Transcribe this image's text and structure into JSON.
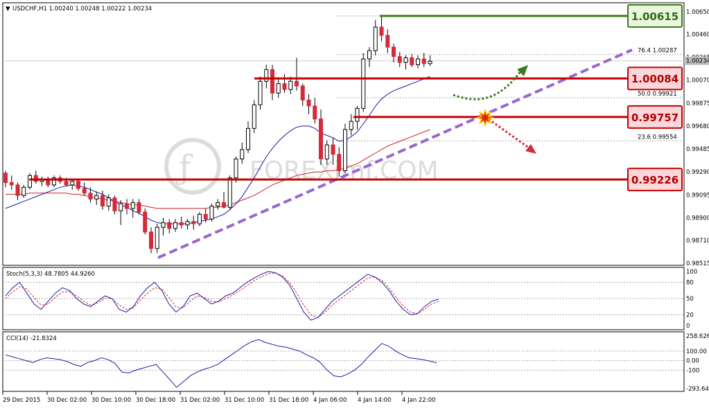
{
  "header": {
    "symbol_line": "USDCHF,H1  1.00240 1.00248 1.00222 1.00234"
  },
  "colors": {
    "bull": "#000000",
    "bear": "#d42a3b",
    "ma_fast": "#1a1aa6",
    "ma_slow": "#cc2222",
    "trendline": "#9966cc",
    "level_line": "#c40000",
    "top_level_line": "#3c7a1e",
    "stoch_main": "#1a1aa6",
    "stoch_signal": "#dd2222",
    "cci": "#1a1aa6"
  },
  "chart_data": [
    {
      "type": "candlestick",
      "symbol": "USDCHF",
      "timeframe": "H1",
      "ylim": [
        0.98515,
        1.0065
      ],
      "y_ticks": [
        "1.00650",
        "1.00460",
        "1.00265",
        "1.00070",
        "0.99875",
        "0.99680",
        "0.99485",
        "0.99290",
        "0.99095",
        "0.98900",
        "0.98710",
        "0.98515"
      ],
      "current_price": "1.00234",
      "x_tick_labels": [
        "29 Dec 2015",
        "30 Dec 02:00",
        "30 Dec 10:00",
        "30 Dec 18:00",
        "31 Dec 02:00",
        "31 Dec 10:00",
        "31 Dec 18:00",
        "4 Jan 06:00",
        "4 Jan 14:00",
        "4 Jan 22:00"
      ],
      "candles": [
        [
          0.9928,
          0.993,
          0.9916,
          0.992
        ],
        [
          0.992,
          0.9926,
          0.9914,
          0.9918
        ],
        [
          0.9918,
          0.992,
          0.9905,
          0.9909
        ],
        [
          0.9909,
          0.9918,
          0.9907,
          0.9916
        ],
        [
          0.9916,
          0.9928,
          0.9914,
          0.9926
        ],
        [
          0.9926,
          0.993,
          0.9919,
          0.9921
        ],
        [
          0.9921,
          0.9925,
          0.9917,
          0.9923
        ],
        [
          0.9923,
          0.9925,
          0.9916,
          0.9918
        ],
        [
          0.9918,
          0.9926,
          0.9916,
          0.9924
        ],
        [
          0.9924,
          0.9926,
          0.9919,
          0.9921
        ],
        [
          0.9921,
          0.9924,
          0.9917,
          0.9918
        ],
        [
          0.9918,
          0.9922,
          0.9914,
          0.9921
        ],
        [
          0.9921,
          0.9922,
          0.9913,
          0.9915
        ],
        [
          0.9915,
          0.992,
          0.9909,
          0.9911
        ],
        [
          0.9911,
          0.9916,
          0.9903,
          0.9906
        ],
        [
          0.9906,
          0.9912,
          0.9901,
          0.9909
        ],
        [
          0.9909,
          0.9913,
          0.9897,
          0.99
        ],
        [
          0.99,
          0.991,
          0.9896,
          0.9907
        ],
        [
          0.9907,
          0.9909,
          0.9893,
          0.9896
        ],
        [
          0.9896,
          0.9905,
          0.9884,
          0.9902
        ],
        [
          0.9902,
          0.9906,
          0.9893,
          0.9898
        ],
        [
          0.9898,
          0.9906,
          0.989,
          0.9903
        ],
        [
          0.9903,
          0.9906,
          0.9893,
          0.9895
        ],
        [
          0.9895,
          0.9898,
          0.9876,
          0.9878
        ],
        [
          0.9878,
          0.9882,
          0.986,
          0.9864
        ],
        [
          0.9864,
          0.9885,
          0.986,
          0.9882
        ],
        [
          0.9882,
          0.989,
          0.9875,
          0.9886
        ],
        [
          0.9886,
          0.9889,
          0.9877,
          0.9881
        ],
        [
          0.9881,
          0.9889,
          0.9878,
          0.9886
        ],
        [
          0.9886,
          0.9891,
          0.9881,
          0.9884
        ],
        [
          0.9884,
          0.9889,
          0.988,
          0.9887
        ],
        [
          0.9887,
          0.9892,
          0.988,
          0.9885
        ],
        [
          0.9885,
          0.9895,
          0.9883,
          0.9893
        ],
        [
          0.9893,
          0.9898,
          0.9886,
          0.9889
        ],
        [
          0.9889,
          0.9902,
          0.9887,
          0.99
        ],
        [
          0.99,
          0.9906,
          0.9897,
          0.9903
        ],
        [
          0.9903,
          0.9912,
          0.9898,
          0.9899
        ],
        [
          0.9899,
          0.9926,
          0.9897,
          0.9924
        ],
        [
          0.9924,
          0.9942,
          0.992,
          0.994
        ],
        [
          0.994,
          0.9954,
          0.9936,
          0.9948
        ],
        [
          0.9948,
          0.9972,
          0.9945,
          0.9966
        ],
        [
          0.9966,
          0.999,
          0.9962,
          0.9986
        ],
        [
          0.9986,
          1.001,
          0.9982,
          1.0006
        ],
        [
          1.0006,
          1.002,
          1.0,
          1.0016
        ],
        [
          1.0016,
          1.002,
          0.999,
          0.9996
        ],
        [
          0.9996,
          1.0008,
          0.9992,
          1.0004
        ],
        [
          1.0004,
          1.0012,
          0.9996,
          0.9999
        ],
        [
          0.9999,
          1.001,
          0.9995,
          1.0006
        ],
        [
          1.0006,
          1.0026,
          0.9998,
          1.0002
        ],
        [
          1.0002,
          1.0004,
          0.9985,
          0.999
        ],
        [
          0.999,
          0.9995,
          0.9978,
          0.9985
        ],
        [
          0.9985,
          0.9992,
          0.997,
          0.9974
        ],
        [
          0.9974,
          0.9982,
          0.9935,
          0.994
        ],
        [
          0.994,
          0.9956,
          0.9935,
          0.9952
        ],
        [
          0.9952,
          0.9958,
          0.9935,
          0.9944
        ],
        [
          0.9944,
          0.995,
          0.9925,
          0.993
        ],
        [
          0.993,
          0.997,
          0.9928,
          0.9965
        ],
        [
          0.9965,
          0.9978,
          0.996,
          0.9972
        ],
        [
          0.9972,
          0.9985,
          0.9965,
          0.9983
        ],
        [
          0.9983,
          1.003,
          0.998,
          1.0025
        ],
        [
          1.0025,
          1.0035,
          1.0018,
          1.0032
        ],
        [
          1.0032,
          1.0058,
          1.0028,
          1.0052
        ],
        [
          1.0052,
          1.0061,
          1.004,
          1.0045
        ],
        [
          1.0045,
          1.005,
          1.003,
          1.0035
        ],
        [
          1.0035,
          1.0038,
          1.0022,
          1.0027
        ],
        [
          1.0027,
          1.0031,
          1.0018,
          1.0022
        ],
        [
          1.0022,
          1.0028,
          1.0016,
          1.0026
        ],
        [
          1.0026,
          1.0029,
          1.0018,
          1.002
        ],
        [
          1.002,
          1.0028,
          1.0017,
          1.0025
        ],
        [
          1.0025,
          1.003,
          1.0018,
          1.0021
        ],
        [
          1.0021,
          1.0028,
          1.0019,
          1.0023
        ]
      ],
      "ma_fast": [
        0.9898,
        0.99,
        0.9902,
        0.9904,
        0.9906,
        0.9908,
        0.991,
        0.9912,
        0.9914,
        0.9916,
        0.9917,
        0.9918,
        0.9917,
        0.9916,
        0.9914,
        0.9912,
        0.991,
        0.9907,
        0.9904,
        0.9901,
        0.9899,
        0.9896,
        0.9894,
        0.9891,
        0.9888,
        0.9886,
        0.9885,
        0.9885,
        0.9885,
        0.9885,
        0.9885,
        0.9886,
        0.9887,
        0.9888,
        0.9889,
        0.9891,
        0.9893,
        0.9897,
        0.9902,
        0.9908,
        0.9916,
        0.9924,
        0.9933,
        0.9942,
        0.9949,
        0.9955,
        0.996,
        0.9964,
        0.9967,
        0.9968,
        0.9968,
        0.9966,
        0.9962,
        0.996,
        0.9958,
        0.9955,
        0.9956,
        0.9959,
        0.9963,
        0.997,
        0.9977,
        0.9985,
        0.9991,
        0.9995,
        0.9998,
        1.0,
        1.0002,
        1.0004,
        1.0006,
        1.0008,
        1.001
      ],
      "ma_slow": [
        0.991,
        0.991,
        0.991,
        0.991,
        0.9911,
        0.9911,
        0.9911,
        0.9911,
        0.9911,
        0.9911,
        0.9911,
        0.991,
        0.991,
        0.9909,
        0.9908,
        0.9907,
        0.9906,
        0.9905,
        0.9904,
        0.9903,
        0.9902,
        0.9901,
        0.9901,
        0.99,
        0.9899,
        0.9898,
        0.9898,
        0.9898,
        0.9898,
        0.9898,
        0.9898,
        0.9898,
        0.9898,
        0.9898,
        0.9899,
        0.9899,
        0.99,
        0.9901,
        0.9903,
        0.9905,
        0.9907,
        0.9909,
        0.9912,
        0.9915,
        0.9918,
        0.992,
        0.9922,
        0.9924,
        0.9926,
        0.9927,
        0.9928,
        0.9929,
        0.9929,
        0.993,
        0.993,
        0.9931,
        0.9932,
        0.9934,
        0.9936,
        0.9939,
        0.9942,
        0.9945,
        0.9948,
        0.9951,
        0.9953,
        0.9955,
        0.9957,
        0.9959,
        0.9961,
        0.9963,
        0.9965
      ]
    },
    {
      "type": "line",
      "name": "Stoch(5,3,3)",
      "label": "Stoch(5,3,3) 48.7805 44.9260",
      "ylim": [
        0,
        100
      ],
      "y_ticks": [
        "100",
        "80",
        "50",
        "20",
        "0"
      ],
      "main": [
        55,
        70,
        80,
        60,
        40,
        30,
        45,
        60,
        70,
        65,
        50,
        40,
        35,
        45,
        55,
        50,
        30,
        25,
        35,
        55,
        70,
        80,
        65,
        40,
        25,
        35,
        55,
        60,
        50,
        40,
        45,
        55,
        60,
        70,
        80,
        88,
        95,
        100,
        98,
        90,
        75,
        50,
        25,
        10,
        15,
        30,
        45,
        55,
        65,
        75,
        85,
        95,
        90,
        80,
        65,
        45,
        30,
        20,
        22,
        35,
        45,
        48.78
      ],
      "signal": [
        50,
        62,
        72,
        68,
        52,
        38,
        40,
        52,
        62,
        63,
        55,
        45,
        38,
        42,
        50,
        50,
        38,
        30,
        33,
        47,
        60,
        70,
        68,
        52,
        35,
        33,
        45,
        55,
        52,
        45,
        44,
        50,
        57,
        65,
        74,
        83,
        90,
        96,
        97,
        92,
        80,
        60,
        38,
        20,
        15,
        25,
        38,
        48,
        58,
        68,
        78,
        88,
        90,
        84,
        70,
        52,
        36,
        25,
        22,
        30,
        40,
        44.93
      ]
    },
    {
      "type": "line",
      "name": "CCI(14)",
      "label": "CCI(14) -21.8324",
      "ylim": [
        -293.6474,
        258.626
      ],
      "y_ticks": [
        "258.626",
        "100.00",
        "0.00",
        "-100",
        "-293.647"
      ],
      "values": [
        60,
        40,
        20,
        0,
        -20,
        10,
        30,
        20,
        10,
        -10,
        -40,
        -60,
        -20,
        0,
        30,
        10,
        -30,
        -120,
        -130,
        -100,
        -80,
        -60,
        -40,
        -120,
        -200,
        -280,
        -220,
        -160,
        -120,
        -90,
        -70,
        -40,
        10,
        60,
        110,
        160,
        200,
        220,
        190,
        170,
        150,
        140,
        120,
        100,
        60,
        30,
        -20,
        -100,
        -160,
        -170,
        -140,
        -100,
        -40,
        40,
        110,
        180,
        150,
        100,
        60,
        30,
        20,
        10,
        -5,
        -21.83
      ]
    }
  ],
  "levels": [
    {
      "label": "1.00615",
      "style": "green"
    },
    {
      "label": "1.00084",
      "style": "red"
    },
    {
      "label": "0.99757",
      "style": "red"
    },
    {
      "label": "0.99226",
      "style": "red"
    }
  ],
  "fib": [
    {
      "text": "76.4  1.00287"
    },
    {
      "text": "50.0  0.99921"
    },
    {
      "text": "23.6  0.99554"
    }
  ],
  "watermark": "FOREXimf.COM"
}
